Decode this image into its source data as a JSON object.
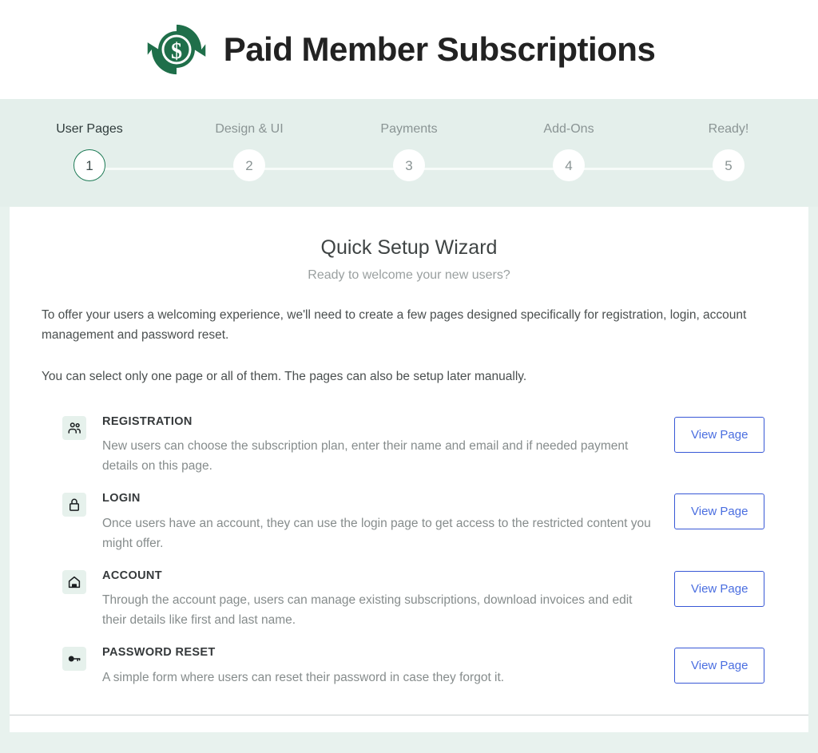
{
  "header": {
    "logo_icon": "circular-arrows-dollar-logo",
    "title": "Paid Member Subscriptions"
  },
  "stepper": {
    "steps": [
      {
        "number": "1",
        "label": "User Pages",
        "active": true
      },
      {
        "number": "2",
        "label": "Design & UI",
        "active": false
      },
      {
        "number": "3",
        "label": "Payments",
        "active": false
      },
      {
        "number": "4",
        "label": "Add-Ons",
        "active": false
      },
      {
        "number": "5",
        "label": "Ready!",
        "active": false
      }
    ],
    "active_color": "#1d7a55",
    "band_background": "#e4efeb"
  },
  "main": {
    "title": "Quick Setup Wizard",
    "subtitle": "Ready to welcome your new users?",
    "intro_paragraph_1": "To offer your users a welcoming experience, we'll need to create a few pages designed specifically for registration, login, account management and password reset.",
    "intro_paragraph_2": "You can select only one page or all of them. The pages can also be setup later manually.",
    "rows": [
      {
        "icon": "users-icon",
        "title": "REGISTRATION",
        "description": "New users can choose the subscription plan, enter their name and email and if needed payment details on this page.",
        "button_label": "View Page"
      },
      {
        "icon": "lock-icon",
        "title": "LOGIN",
        "description": "Once users have an account, they can use the login page to get access to the restricted content you might offer.",
        "button_label": "View Page"
      },
      {
        "icon": "home-icon",
        "title": "ACCOUNT",
        "description": "Through the account page, users can manage existing subscriptions, download invoices and edit their details like first and last name.",
        "button_label": "View Page"
      },
      {
        "icon": "key-icon",
        "title": "PASSWORD RESET",
        "description": "A simple form where users can reset their password in case they forgot it.",
        "button_label": "View Page"
      }
    ],
    "button_accent_color": "#4a6ee0"
  }
}
